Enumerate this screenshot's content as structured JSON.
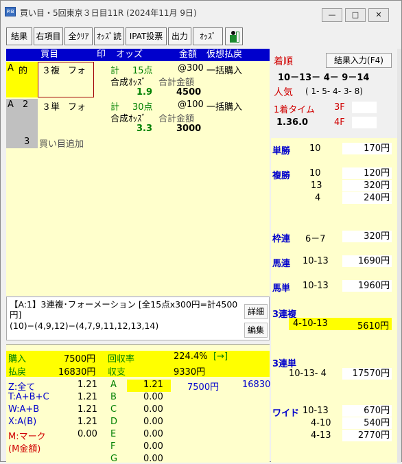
{
  "window": {
    "title": "買い目・5回東京３日目11R (2024年11月 9日)",
    "app_icon": "app-icon",
    "min_glyph": "—",
    "max_glyph": "□",
    "close_glyph": "✕"
  },
  "toolbar": {
    "buttons": [
      "結果",
      "右項目",
      "全ｸﾘｱ",
      "ｵｯｽﾞ読",
      "IPAT投票",
      "出力",
      "ｵｯｽﾞ"
    ],
    "person_icon": "exit-person-icon"
  },
  "table": {
    "headers": [
      "買目",
      "印",
      "オッズ",
      "金額",
      "仮想払戻"
    ],
    "rows": [
      {
        "sel": "A",
        "flag": "的",
        "type": "３複",
        "method": "フォ",
        "points_label": "計",
        "points": "15点",
        "unit": "@300",
        "mode": "一括購入",
        "syn_label": "合成ｵｯｽﾞ",
        "total_label": "合計金額",
        "syn_odds": "1.9",
        "total": "4500"
      },
      {
        "sel": "A",
        "flag": "2",
        "type": "３単",
        "method": "フォ",
        "points_label": "計",
        "points": "30点",
        "unit": "@100",
        "mode": "一括購入",
        "syn_label": "合成ｵｯｽﾞ",
        "total_label": "合計金額",
        "syn_odds": "3.3",
        "total": "3000"
      }
    ],
    "add_row": {
      "num": "3",
      "label": "買い目追加"
    }
  },
  "detail": {
    "text1": "【A:1】3連複･フォーメーション [全15点x300円=計4500円]",
    "text2": "(10)−(4,9,12)−(4,7,9,11,12,13,14)",
    "detail_btn": "詳細",
    "edit_btn": "編集"
  },
  "summary": {
    "buy_label": "購入",
    "buy": "7500円",
    "recov_label": "回収率",
    "recov": "224.4%",
    "arrow": "[→]",
    "pay_label": "払戻",
    "pay": "16830円",
    "balance_label": "収支",
    "balance": "9330円",
    "groups": [
      {
        "name": "Z:全て",
        "val": "1.21"
      },
      {
        "name": "T:A+B+C",
        "val": "1.21"
      },
      {
        "name": "W:A+B",
        "val": "1.21"
      },
      {
        "name": "X:A(B)",
        "val": "1.21"
      },
      {
        "name": "M:マーク",
        "val": "0.00"
      },
      {
        "name": "(M金額)",
        "val": ""
      }
    ],
    "letters": [
      {
        "l": "A",
        "v": "1.21"
      },
      {
        "l": "B",
        "v": "0.00"
      },
      {
        "l": "C",
        "v": "0.00"
      },
      {
        "l": "D",
        "v": "0.00"
      },
      {
        "l": "E",
        "v": "0.00"
      },
      {
        "l": "F",
        "v": "0.00"
      },
      {
        "l": "G",
        "v": "0.00"
      }
    ],
    "a_buy": "7500円",
    "a_pay": "16830"
  },
  "result": {
    "order_label": "着順",
    "input_btn": "結果入力(F4)",
    "order": "10－13－ 4－ 9－14",
    "pop_label": "人気",
    "pop": "( 1- 5- 4- 3- 8)",
    "time_label": "1着タイム",
    "f3": "3F",
    "time": "1.36.0",
    "f4": "4F"
  },
  "payouts": {
    "tansho": {
      "label": "単勝",
      "items": [
        {
          "n": "10",
          "p": "170円"
        }
      ]
    },
    "fukusho": {
      "label": "複勝",
      "items": [
        {
          "n": "10",
          "p": "120円"
        },
        {
          "n": "13",
          "p": "320円"
        },
        {
          "n": "4",
          "p": "240円"
        }
      ]
    },
    "wakuren": {
      "label": "枠連",
      "items": [
        {
          "n": "6－7",
          "p": "320円"
        }
      ]
    },
    "umaren": {
      "label": "馬連",
      "items": [
        {
          "n": "10-13",
          "p": "1690円"
        }
      ]
    },
    "umatan": {
      "label": "馬単",
      "items": [
        {
          "n": "10-13",
          "p": "1960円"
        }
      ]
    },
    "sanrenpuku": {
      "label": "3連複",
      "items": [
        {
          "n": "4-10-13",
          "p": "5610円"
        }
      ]
    },
    "sanrentan": {
      "label": "3連単",
      "items": [
        {
          "n": "10-13- 4",
          "p": "17570円"
        }
      ]
    },
    "wide": {
      "label": "ワイド",
      "items": [
        {
          "n": "10-13",
          "p": "670円"
        },
        {
          "n": "4-10",
          "p": "540円"
        },
        {
          "n": "4-13",
          "p": "2770円"
        }
      ]
    }
  },
  "colors": {
    "header_bg": "#0000cc",
    "pane_bg": "#ffffcc",
    "highlight": "#ffff00",
    "label_blue": "#0000cc",
    "label_red": "#d00000"
  }
}
